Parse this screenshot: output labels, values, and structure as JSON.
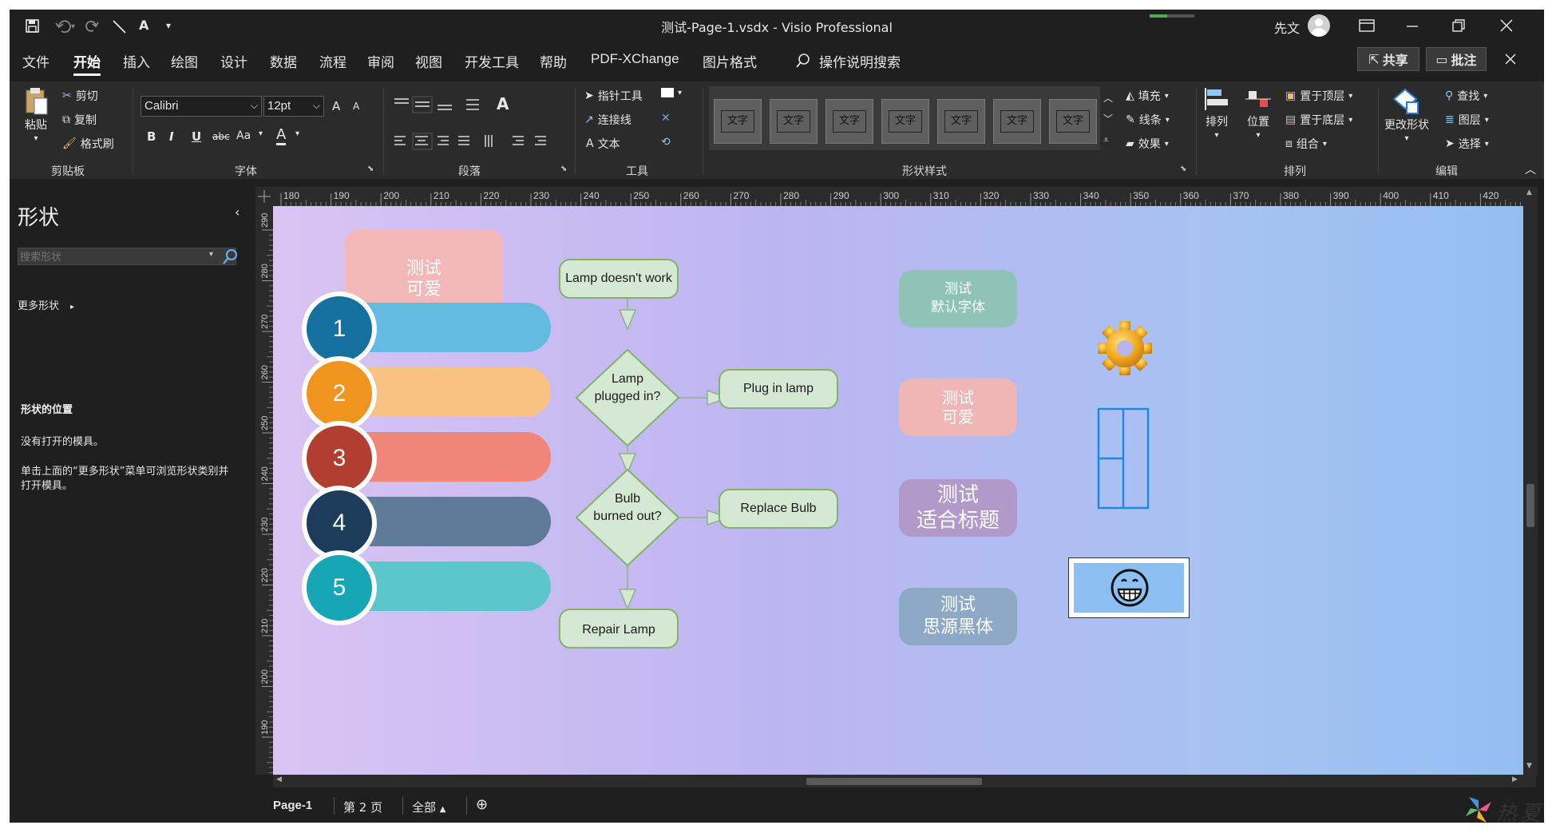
{
  "window": {
    "title": "测试-Page-1.vsdx  -  Visio Professional",
    "user": "先文",
    "quick_access": {
      "font_tool_label": "A"
    }
  },
  "tabs": [
    "文件",
    "开始",
    "插入",
    "绘图",
    "设计",
    "数据",
    "流程",
    "审阅",
    "视图",
    "开发工具",
    "帮助",
    "PDF-XChange",
    "图片格式"
  ],
  "active_tab": "开始",
  "tell_me": "操作说明搜索",
  "share_label": "共享",
  "comments_label": "批注",
  "ribbon": {
    "clipboard": {
      "paste": "粘贴",
      "cut": "剪切",
      "copy": "复制",
      "format_painter": "格式刷",
      "label": "剪贴板"
    },
    "font": {
      "name": "Calibri",
      "size": "12pt",
      "grow": "A",
      "shrink": "A",
      "bold": "B",
      "italic": "I",
      "underline": "U",
      "strike": "abc",
      "case": "Aa",
      "color": "A",
      "label": "字体"
    },
    "paragraph": {
      "label": "段落",
      "text_btn": "A"
    },
    "tools": {
      "pointer": "指针工具",
      "connector": "连接线",
      "text": "文本",
      "text_icon": "A",
      "label": "工具"
    },
    "shape_styles": {
      "tile_text": "文字",
      "tile_count": 7,
      "fill": "填充",
      "line": "线条",
      "effect": "效果",
      "label": "形状样式"
    },
    "arrange": {
      "align": "排列",
      "position": "位置",
      "bring_front": "置于顶层",
      "send_back": "置于底层",
      "group": "组合",
      "label": "排列"
    },
    "editing": {
      "change_shape": "更改形状",
      "find": "查找",
      "layers": "图层",
      "select": "选择",
      "label": "编辑"
    }
  },
  "shapes_pane": {
    "title": "形状",
    "search_placeholder": "搜索形状",
    "more_shapes": "更多形状",
    "stencil_title": "形状的位置",
    "no_stencils": "没有打开的模具。",
    "hint": "单击上面的“更多形状”菜单可浏览形状类别并打开模具。"
  },
  "ruler": {
    "h": [
      "180",
      "190",
      "200",
      "210",
      "220",
      "230",
      "240",
      "250",
      "260",
      "270",
      "280",
      "290",
      "300",
      "310",
      "320",
      "330",
      "340",
      "350",
      "360",
      "370",
      "380",
      "390",
      "400",
      "410",
      "420"
    ],
    "v": [
      "290",
      "280",
      "270",
      "260",
      "250",
      "240",
      "230",
      "220",
      "210",
      "200",
      "190"
    ]
  },
  "canvas": {
    "top_box": [
      "测试",
      "可爱"
    ],
    "list_items": [
      {
        "num": "1",
        "circle": "#14709f",
        "bar": "#63bbe1"
      },
      {
        "num": "2",
        "circle": "#f0931f",
        "bar": "#f7c282"
      },
      {
        "num": "3",
        "circle": "#b03e31",
        "bar": "#f0867a"
      },
      {
        "num": "4",
        "circle": "#1d3b5b",
        "bar": "#5e7c98"
      },
      {
        "num": "5",
        "circle": "#17a6b4",
        "bar": "#5cc6cc"
      }
    ],
    "flowchart": {
      "start": "Lamp doesn't work",
      "q1": [
        "Lamp",
        "plugged in?"
      ],
      "a1": "Plug in lamp",
      "q2": [
        "Bulb",
        "burned out?"
      ],
      "a2": "Replace Bulb",
      "end": "Repair Lamp"
    },
    "right_boxes": [
      {
        "lines": [
          "测试",
          "默认字体"
        ],
        "color": "#8fc3b8"
      },
      {
        "lines": [
          "测试",
          "可爱"
        ],
        "color": "#f0b5b5"
      },
      {
        "lines": [
          "测试",
          "适合标题"
        ],
        "color": "#b19ac9"
      },
      {
        "lines": [
          "测试",
          "思源黑体"
        ],
        "color": "#8ea9c6"
      }
    ]
  },
  "status": {
    "page1": "Page-1",
    "page2": "第 2 页",
    "all": "全部",
    "add": "⊕"
  },
  "watermark": "热夏"
}
